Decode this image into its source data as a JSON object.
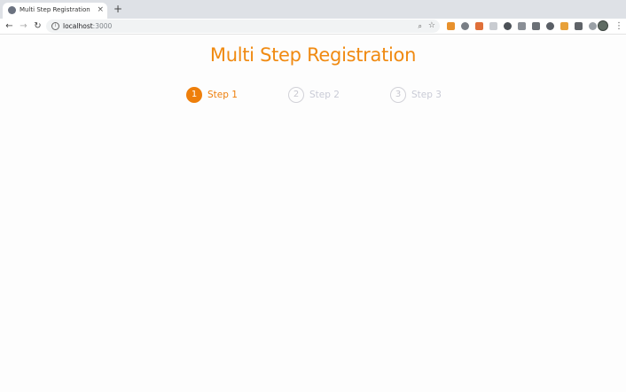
{
  "browser": {
    "tab": {
      "title": "Multi Step Registration",
      "close_glyph": "×",
      "favicon": "globe-icon"
    },
    "new_tab_glyph": "+",
    "nav": {
      "back_glyph": "←",
      "forward_glyph": "→",
      "reload_glyph": "↻"
    },
    "address": {
      "host": "localhost",
      "port": ":3000",
      "info_glyph": "i",
      "zoom_glyph": "⌕",
      "star_glyph": "☆"
    },
    "menu_glyph": "⋮",
    "extensions": [
      {
        "name": "extension-1-icon",
        "color": "#e8912d"
      },
      {
        "name": "extension-2-icon",
        "color": "#7a7f86"
      },
      {
        "name": "extension-3-icon",
        "color": "#e0703a"
      },
      {
        "name": "extension-4-icon",
        "color": "#c9ccd1"
      },
      {
        "name": "extension-5-icon",
        "color": "#4c5157"
      },
      {
        "name": "extension-6-icon",
        "color": "#8a8f96"
      },
      {
        "name": "extension-7-icon",
        "color": "#6b7076"
      },
      {
        "name": "extension-8-icon",
        "color": "#5a5f66"
      },
      {
        "name": "extension-9-icon",
        "color": "#e8a13a"
      },
      {
        "name": "extension-10-icon",
        "color": "#5f6368"
      },
      {
        "name": "extension-11-icon",
        "color": "#9aa0a6"
      }
    ]
  },
  "page": {
    "title": "Multi Step Registration",
    "steps": [
      {
        "number": "1",
        "label": "Step 1",
        "state": "active"
      },
      {
        "number": "2",
        "label": "Step 2",
        "state": "inactive"
      },
      {
        "number": "3",
        "label": "Step 3",
        "state": "inactive"
      }
    ]
  },
  "colors": {
    "accent": "#ee7f0b",
    "inactive": "#c9cbd6"
  }
}
